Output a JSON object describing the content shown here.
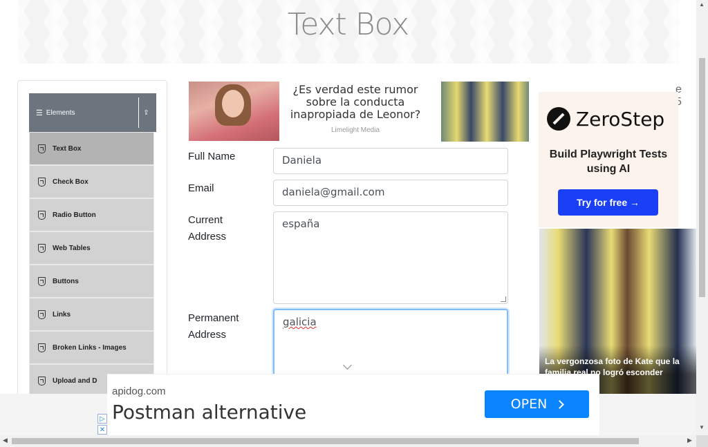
{
  "page": {
    "title": "Text Box"
  },
  "sidebar": {
    "group_label": "Elements",
    "items": [
      {
        "label": "Text Box",
        "active": true
      },
      {
        "label": "Check Box",
        "active": false
      },
      {
        "label": "Radio Button",
        "active": false
      },
      {
        "label": "Web Tables",
        "active": false
      },
      {
        "label": "Buttons",
        "active": false
      },
      {
        "label": "Links",
        "active": false
      },
      {
        "label": "Broken Links - Images",
        "active": false
      },
      {
        "label": "Upload and D",
        "active": false
      }
    ]
  },
  "top_ad": {
    "headline": "¿Es verdad este rumor sobre la conducta inapropiada de Leonor?",
    "source": "Limelight Media"
  },
  "form": {
    "full_name": {
      "label": "Full Name",
      "value": "Daniela"
    },
    "email": {
      "label": "Email",
      "value": "daniela@gmail.com"
    },
    "current_address": {
      "label_line1": "Current",
      "label_line2": "Address",
      "value": "españa"
    },
    "permanent_address": {
      "label_line1": "Permanent",
      "label_line2": "Address",
      "value": "galicia"
    }
  },
  "right_ad": {
    "peek_text": "e\n5",
    "brand": "ZeroStep",
    "tagline": "Build Playwright Tests using AI",
    "cta": "Try for free →",
    "caption": "La vergonzosa foto de Kate que la familia real no logró esconder"
  },
  "bottom_ad": {
    "host": "apidog.com",
    "headline": "Postman alternative",
    "cta": "OPEN"
  },
  "colors": {
    "sidebar_header": "#6c757d",
    "sidebar_item": "#d2d2d2",
    "sidebar_active": "#b3b3b3",
    "focus_border": "#80bdff",
    "zerostep_button": "#1a3ff4",
    "open_button": "#0a84ff"
  },
  "icons": {
    "menu": "hamburger-icon",
    "collapse": "chevron-up-icon",
    "item": "html5-icon",
    "adchoices": "adchoices-icon"
  }
}
